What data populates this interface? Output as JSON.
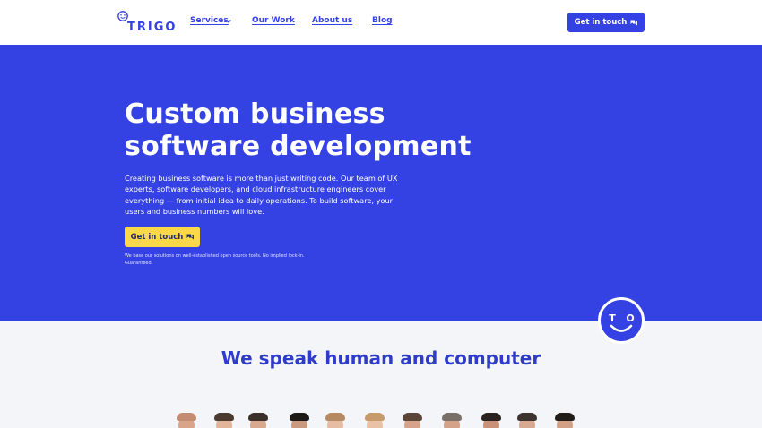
{
  "header": {
    "logo_text": "TRIGO",
    "nav": [
      {
        "label": "Services"
      },
      {
        "label": "Our Work"
      },
      {
        "label": "About us"
      },
      {
        "label": "Blog"
      }
    ],
    "cta_label": "Get in touch"
  },
  "hero": {
    "title": "Custom business software development",
    "description": "Creating business software is more than just writing code. Our team of UX experts, software developers, and cloud infrastructure engineers cover everything — from initial idea to daily operations. To build software, your users and business numbers will love.",
    "cta_label": "Get in touch",
    "note": "We base our solutions on well-established open source tools. No implied lock-in. Guaranteed."
  },
  "badge": {
    "left_letter": "T",
    "right_letter": "O"
  },
  "section": {
    "title": "We speak human and computer"
  },
  "colors": {
    "brand_blue": "#3441e3",
    "accent_yellow": "#fbd84a",
    "white": "#ffffff",
    "page_bg": "#f3f5f8"
  },
  "icons": [
    "smiley-logo-icon",
    "chevron-down-icon",
    "chat-bubble-icon"
  ]
}
